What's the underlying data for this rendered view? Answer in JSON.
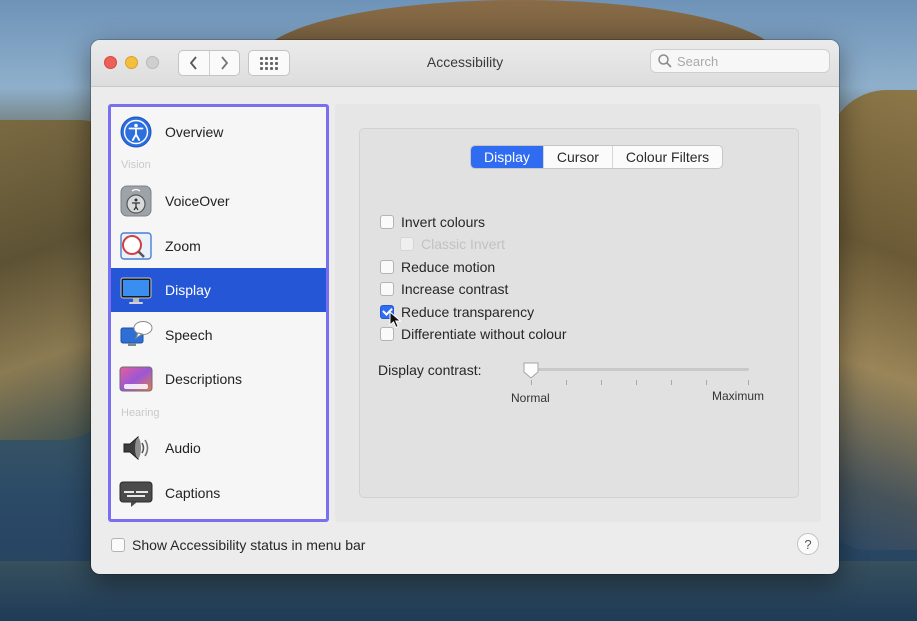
{
  "window": {
    "title": "Accessibility",
    "search_placeholder": "Search",
    "nav_back": "‹",
    "nav_forward": "›",
    "help": "?"
  },
  "sidebar": {
    "items": [
      {
        "label": "Overview",
        "icon": "accessibility-icon",
        "selected": false
      },
      {
        "label": "VoiceOver",
        "icon": "voiceover-icon",
        "selected": false
      },
      {
        "label": "Zoom",
        "icon": "zoom-icon",
        "selected": false
      },
      {
        "label": "Display",
        "icon": "display-icon",
        "selected": true
      },
      {
        "label": "Speech",
        "icon": "speech-icon",
        "selected": false
      },
      {
        "label": "Descriptions",
        "icon": "descriptions-icon",
        "selected": false
      },
      {
        "label": "Audio",
        "icon": "speaker-icon",
        "selected": false
      },
      {
        "label": "Captions",
        "icon": "captions-icon",
        "selected": false
      }
    ],
    "sections": {
      "vision": "Vision",
      "hearing": "Hearing"
    }
  },
  "tabs": [
    {
      "label": "Display",
      "active": true
    },
    {
      "label": "Cursor",
      "active": false
    },
    {
      "label": "Colour Filters",
      "active": false
    }
  ],
  "options": [
    {
      "label": "Invert colours",
      "checked": false,
      "disabled": false
    },
    {
      "label": "Classic Invert",
      "checked": false,
      "disabled": true
    },
    {
      "label": "Reduce motion",
      "checked": false,
      "disabled": false
    },
    {
      "label": "Increase contrast",
      "checked": false,
      "disabled": false
    },
    {
      "label": "Reduce transparency",
      "checked": true,
      "disabled": false
    },
    {
      "label": "Differentiate without colour",
      "checked": false,
      "disabled": false
    }
  ],
  "contrast": {
    "label": "Display contrast:",
    "min_label": "Normal",
    "max_label": "Maximum",
    "value": 0
  },
  "footer": {
    "menu_bar_label": "Show Accessibility status in menu bar",
    "menu_bar_checked": false
  },
  "colors": {
    "accent": "#2f6cf2",
    "selection": "#2456d6",
    "sidebar_outline": "#7a6ff0"
  }
}
